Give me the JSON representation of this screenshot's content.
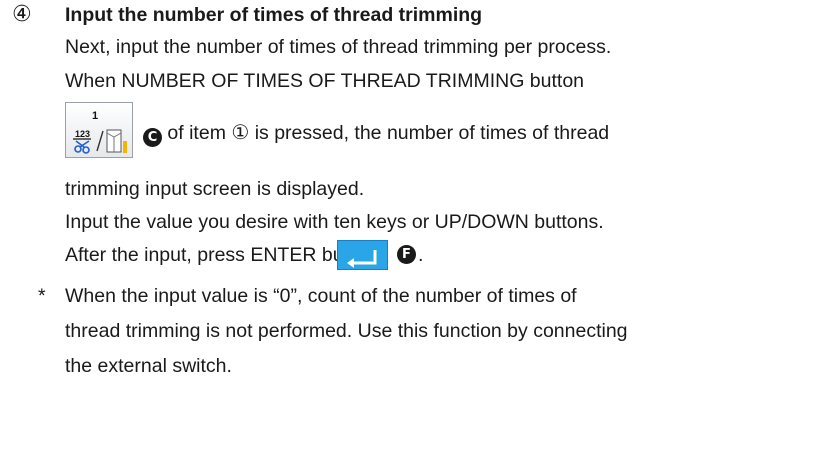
{
  "step": {
    "number": "④",
    "title": "Input the number of times of thread trimming"
  },
  "paragraph1": {
    "line1": "Next, input the number of times of thread trimming per process.",
    "line2": "When NUMBER OF TIMES OF THREAD TRIMMING button",
    "badge_c": "C",
    "line3_a": " of item ",
    "item_ref": "①",
    "line3_b": " is pressed, the number of times of thread",
    "line4": "trimming input screen is displayed."
  },
  "icon_button": {
    "icon": "thread-trimming-count-icon",
    "superscript": "1",
    "fraction_label": "123"
  },
  "paragraph2": {
    "line1": "Input the value you desire with ten keys or UP/DOWN buttons.",
    "line2": "After the input, press ENTER button",
    "badge_f": "F",
    "period": "."
  },
  "enter_button": {
    "icon": "enter-return-icon",
    "color": "#2aa6e8"
  },
  "note": {
    "bullet": "*",
    "line1": "When the input value is “0”, count of the number of times of",
    "line2": "thread trimming is not performed.  Use this function by connecting",
    "line3": "the external switch."
  }
}
